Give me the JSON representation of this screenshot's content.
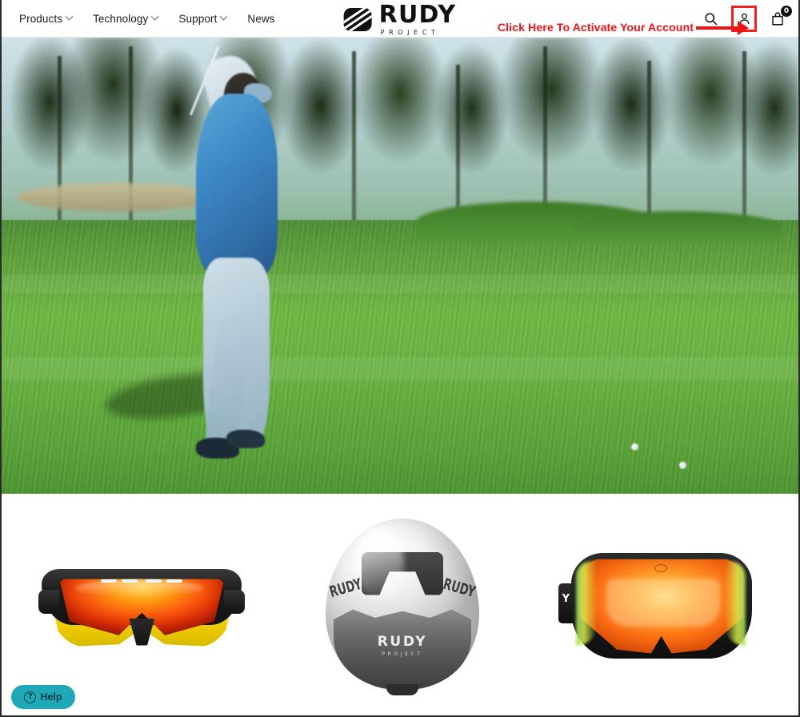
{
  "site": {
    "brand_name": "RUDY",
    "brand_sub": "PROJECT",
    "logo_icon": "rudy-stripes-logo-icon"
  },
  "header": {
    "nav_items": [
      {
        "label": "Products",
        "has_dropdown": true,
        "icon": "chevron-down-icon"
      },
      {
        "label": "Technology",
        "has_dropdown": true,
        "icon": "chevron-down-icon"
      },
      {
        "label": "Support",
        "has_dropdown": true,
        "icon": "chevron-down-icon"
      },
      {
        "label": "News",
        "has_dropdown": false,
        "icon": ""
      }
    ],
    "icons": {
      "search": "search-icon",
      "account": "user-account-icon",
      "bag": "shopping-bag-icon",
      "bag_count": "0"
    },
    "highlight_color": "#f41d1d"
  },
  "annotation": {
    "text": "Click Here To Activate Your Account",
    "color": "#f01313",
    "arrow": "arrow-right-icon",
    "target": "account-icon"
  },
  "hero": {
    "type": "video",
    "description": "Golfer mid-swing on a green golf course fairway with trees",
    "subject": "golfer-swinging",
    "sky_color": "#cfe3e8",
    "grass_color": "#6fba43"
  },
  "products": [
    {
      "name": "sport-sunglasses",
      "label": "Sport Sunglasses",
      "frame_color": "#1d1d1d",
      "accent_color": "#f5d400",
      "lens_color": "#f8570c"
    },
    {
      "name": "aero-helmet",
      "label": "Aero Helmet",
      "shell_color": "#f4f4f4",
      "lower_color": "#555555",
      "brand_text": "RUDY",
      "brand_sub": "PROJECT"
    },
    {
      "name": "ski-goggles",
      "label": "Ski Goggles",
      "frame_color": "#0e0e0e",
      "lens_color": "#ff8a1f",
      "strap_text": "Y"
    }
  ],
  "help_widget": {
    "label": "Help",
    "icon": "question-mark-icon",
    "background": "#1fa8b8"
  }
}
